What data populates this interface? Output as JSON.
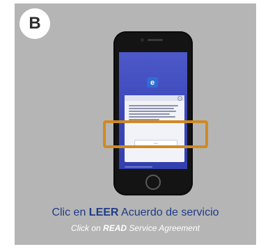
{
  "badge": {
    "label": "B"
  },
  "screen": {
    "app_logo_letter": "e",
    "read_button_label": "Leer"
  },
  "caption": {
    "main_prefix": "Clic en ",
    "main_bold": "LEER",
    "main_suffix": " Acuerdo de servicio",
    "sub_prefix": "Click on ",
    "sub_bold": "READ",
    "sub_suffix": " Service Agreement"
  },
  "colors": {
    "panel_bg": "#b5b5b5",
    "highlight": "#d08a21",
    "caption_main": "#1f3b86",
    "caption_sub": "#ffffff",
    "screen_bg": "#3b47b8"
  }
}
